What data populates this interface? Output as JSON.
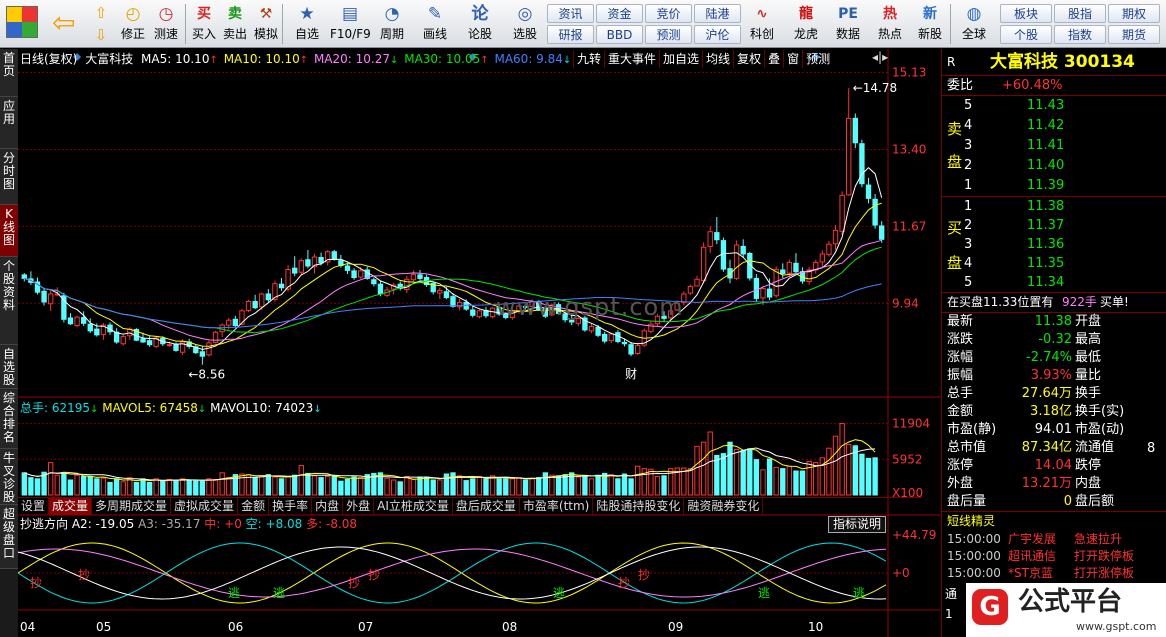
{
  "toolbar": {
    "nav": [
      {
        "label": "修正",
        "icon": "refresh-icon"
      },
      {
        "label": "测速",
        "icon": "clock-icon"
      }
    ],
    "trade": [
      {
        "label": "买入",
        "icon": "buy-icon",
        "ic": "买"
      },
      {
        "label": "卖出",
        "icon": "sell-icon",
        "ic": "卖"
      },
      {
        "label": "模拟",
        "icon": "hammer-icon",
        "ic": "⚒"
      }
    ],
    "tools": [
      {
        "label": "自选",
        "icon": "star-icon",
        "ic": "★"
      },
      {
        "label": "F10/F9",
        "icon": "f10-icon",
        "ic": "▤"
      },
      {
        "label": "周期",
        "icon": "cycle-icon",
        "ic": "◔"
      },
      {
        "label": "画线",
        "icon": "pencil-icon",
        "ic": "✎"
      },
      {
        "label": "论股",
        "icon": "chat-icon",
        "ic": "论"
      },
      {
        "label": "选股",
        "icon": "stock-pick-icon",
        "ic": "◎"
      }
    ],
    "small": [
      [
        "资讯",
        "资金",
        "竞价",
        "陆港"
      ],
      [
        "研报",
        "BBD",
        "预测",
        "沪伦"
      ]
    ],
    "more": [
      {
        "label": "科创",
        "icon": "chart-icon",
        "ic": "∿"
      },
      {
        "label": "龙虎",
        "icon": "dragon-icon",
        "ic": "龍"
      },
      {
        "label": "数据",
        "icon": "pe-icon",
        "ic": "PE"
      },
      {
        "label": "热点",
        "icon": "fire-icon",
        "ic": "热"
      },
      {
        "label": "新股",
        "icon": "ipo-icon",
        "ic": "新"
      }
    ],
    "globe": {
      "label": "全球",
      "icon": "globe-icon",
      "ic": "◍"
    },
    "small2": [
      [
        "板块",
        "股指",
        "期权"
      ],
      [
        "个股",
        "指数",
        "期货"
      ]
    ]
  },
  "leftbar": [
    {
      "label": "首页",
      "act": false
    },
    {
      "label": "应用",
      "act": false
    },
    {
      "label": "分时图",
      "act": false
    },
    {
      "label": "K线图",
      "act": true
    },
    {
      "label": "个股资料",
      "act": false
    },
    {
      "label": "自选股",
      "act": false
    },
    {
      "label": "综合排名",
      "act": false
    },
    {
      "label": "牛叉诊股",
      "act": false
    },
    {
      "label": "超级盘口",
      "act": false
    }
  ],
  "chart": {
    "header": {
      "period": "日线(复权)",
      "name": "大富科技",
      "ma5": "MA5: 10.10",
      "ma10": "MA10: 10.10",
      "ma20": "MA20: 10.27",
      "ma30": "MA30: 10.05",
      "ma60": "MA60: 9.84"
    },
    "top_buttons": [
      "九转",
      "重大事件",
      "加自选",
      "均线",
      "复权",
      "叠",
      "窗",
      "预测"
    ],
    "watermark": "www.gspt.com",
    "vol_header": {
      "total": "总手: 62195",
      "ma5": "MAVOL5: 67458",
      "ma10": "MAVOL10: 74023"
    },
    "tabs": [
      "设置",
      "成交量",
      "多周期成交量",
      "虚拟成交量",
      "金额",
      "换手率",
      "内盘",
      "外盘",
      "AI立桩成交量",
      "盘后成交量",
      "市盈率(ttm)",
      "陆股通持股变化",
      "融资融券变化"
    ],
    "ind_header": {
      "name": "抄逃方向",
      "a2": "A2: -19.05",
      "a3": "A3: -35.17",
      "zhong": "中: +0",
      "kong": "空: +8.08",
      "duo": "多: -8.08"
    },
    "ind_button": "指标说明",
    "xlabels": [
      "04",
      "05",
      "06",
      "07",
      "08",
      "09",
      "10"
    ],
    "marks": {
      "high": "14.78",
      "low": "8.56",
      "cai": "财",
      "chao": "抄",
      "tao": "逃"
    }
  },
  "chart_data": {
    "type": "candlestick",
    "price_ticks": [
      "15.13",
      "13.40",
      "11.67",
      "9.94"
    ],
    "volume_ticks": [
      "11904",
      "5952",
      "X100"
    ],
    "ind_ticks": [
      "+44.79",
      "+0"
    ],
    "ohlc": [
      [
        10.58,
        10.62,
        10.43,
        10.5
      ],
      [
        10.49,
        10.66,
        10.35,
        10.41
      ],
      [
        10.42,
        10.52,
        10.14,
        10.19
      ],
      [
        10.21,
        10.29,
        9.89,
        9.97
      ],
      [
        9.93,
        10.22,
        9.77,
        10.15
      ],
      [
        10.15,
        10.3,
        10.11,
        10.15
      ],
      [
        10.11,
        10.18,
        9.51,
        9.58
      ],
      [
        9.61,
        9.72,
        9.45,
        9.48
      ],
      [
        9.44,
        9.66,
        9.4,
        9.63
      ],
      [
        9.62,
        9.76,
        9.43,
        9.49
      ],
      [
        9.47,
        9.6,
        9.27,
        9.32
      ],
      [
        9.36,
        9.49,
        9.19,
        9.23
      ],
      [
        9.24,
        9.5,
        9.12,
        9.45
      ],
      [
        9.45,
        9.51,
        9.23,
        9.3
      ],
      [
        9.29,
        9.38,
        9.03,
        9.07
      ],
      [
        9.03,
        9.23,
        8.99,
        9.19
      ],
      [
        9.21,
        9.4,
        9.12,
        9.36
      ],
      [
        9.35,
        9.38,
        9.09,
        9.11
      ],
      [
        9.14,
        9.28,
        9.05,
        9.07
      ],
      [
        9.1,
        9.21,
        8.96,
        9.01
      ],
      [
        8.97,
        9.19,
        8.93,
        9.16
      ],
      [
        9.15,
        9.2,
        8.98,
        9.03
      ],
      [
        9.01,
        9.08,
        8.96,
        9.01
      ],
      [
        9.02,
        9.06,
        8.85,
        8.88
      ],
      [
        8.84,
        9.13,
        8.78,
        9.07
      ],
      [
        9.07,
        9.14,
        8.92,
        8.97
      ],
      [
        8.96,
        9.01,
        8.8,
        8.83
      ],
      [
        8.85,
        8.98,
        8.56,
        8.75
      ],
      [
        8.78,
        9.1,
        8.74,
        9.05
      ],
      [
        9.06,
        9.32,
        9.04,
        9.29
      ],
      [
        9.3,
        9.49,
        9.18,
        9.45
      ],
      [
        9.45,
        9.61,
        9.35,
        9.56
      ],
      [
        9.58,
        9.66,
        9.4,
        9.44
      ],
      [
        9.47,
        9.82,
        9.44,
        9.77
      ],
      [
        9.78,
        10.02,
        9.74,
        9.98
      ],
      [
        9.98,
        10.13,
        9.81,
        9.84
      ],
      [
        9.86,
        10.18,
        9.79,
        10.15
      ],
      [
        10.15,
        10.26,
        9.97,
        10.02
      ],
      [
        10.03,
        10.45,
        9.98,
        10.38
      ],
      [
        10.37,
        10.51,
        10.22,
        10.29
      ],
      [
        10.26,
        10.8,
        10.2,
        10.7
      ],
      [
        10.73,
        11.0,
        10.55,
        10.62
      ],
      [
        10.64,
        10.95,
        10.59,
        10.9
      ],
      [
        10.92,
        11.14,
        10.73,
        10.78
      ],
      [
        10.76,
        11.05,
        10.61,
        10.98
      ],
      [
        10.97,
        11.08,
        10.79,
        10.85
      ],
      [
        10.87,
        11.14,
        10.79,
        11.1
      ],
      [
        11.1,
        11.14,
        10.9,
        10.93
      ],
      [
        10.9,
        11.03,
        10.74,
        10.79
      ],
      [
        10.78,
        10.85,
        10.6,
        10.68
      ],
      [
        10.67,
        10.73,
        10.47,
        10.52
      ],
      [
        10.53,
        10.75,
        10.49,
        10.67
      ],
      [
        10.69,
        10.76,
        10.47,
        10.5
      ],
      [
        10.47,
        10.52,
        10.32,
        10.38
      ],
      [
        10.37,
        10.44,
        10.1,
        10.15
      ],
      [
        10.12,
        10.31,
        10.08,
        10.24
      ],
      [
        10.26,
        10.4,
        10.14,
        10.35
      ],
      [
        10.37,
        10.43,
        10.23,
        10.28
      ],
      [
        10.25,
        10.56,
        10.17,
        10.48
      ],
      [
        10.47,
        10.68,
        10.41,
        10.59
      ],
      [
        10.58,
        10.69,
        10.45,
        10.5
      ],
      [
        10.52,
        10.58,
        10.31,
        10.36
      ],
      [
        10.39,
        10.43,
        10.14,
        10.2
      ],
      [
        10.17,
        10.29,
        10.04,
        10.23
      ],
      [
        10.2,
        10.31,
        10.03,
        10.07
      ],
      [
        10.09,
        10.17,
        9.84,
        9.87
      ],
      [
        9.86,
        10.04,
        9.78,
        9.96
      ],
      [
        9.96,
        10.03,
        9.77,
        9.81
      ],
      [
        9.79,
        9.9,
        9.62,
        9.67
      ],
      [
        9.64,
        9.81,
        9.6,
        9.77
      ],
      [
        9.78,
        9.86,
        9.61,
        9.66
      ],
      [
        9.64,
        9.86,
        9.6,
        9.83
      ],
      [
        9.84,
        9.9,
        9.66,
        9.7
      ],
      [
        9.69,
        9.73,
        9.58,
        9.62
      ],
      [
        9.62,
        9.81,
        9.57,
        9.78
      ],
      [
        9.77,
        9.95,
        9.71,
        9.88
      ],
      [
        9.87,
        9.94,
        9.8,
        9.85
      ],
      [
        9.87,
        10.03,
        9.85,
        9.98
      ],
      [
        9.98,
        10.01,
        9.77,
        9.8
      ],
      [
        9.81,
        9.85,
        9.61,
        9.65
      ],
      [
        9.68,
        9.93,
        9.65,
        9.9
      ],
      [
        9.91,
        9.96,
        9.68,
        9.71
      ],
      [
        9.7,
        9.75,
        9.51,
        9.57
      ],
      [
        9.56,
        9.69,
        9.45,
        9.52
      ],
      [
        9.49,
        9.64,
        9.43,
        9.6
      ],
      [
        9.61,
        9.66,
        9.3,
        9.34
      ],
      [
        9.32,
        9.48,
        9.27,
        9.42
      ],
      [
        9.4,
        9.45,
        9.18,
        9.22
      ],
      [
        9.24,
        9.3,
        9.04,
        9.09
      ],
      [
        9.1,
        9.28,
        9.05,
        9.25
      ],
      [
        9.28,
        9.34,
        9.04,
        9.08
      ],
      [
        9.06,
        9.15,
        8.97,
        9.03
      ],
      [
        9.01,
        9.07,
        8.75,
        8.8
      ],
      [
        8.81,
        9.05,
        8.78,
        8.99
      ],
      [
        9.0,
        9.37,
        8.96,
        9.32
      ],
      [
        9.31,
        9.53,
        9.26,
        9.47
      ],
      [
        9.48,
        9.7,
        9.42,
        9.65
      ],
      [
        9.65,
        9.76,
        9.52,
        9.6
      ],
      [
        9.61,
        9.82,
        9.54,
        9.77
      ],
      [
        9.79,
        10.0,
        9.77,
        9.94
      ],
      [
        9.96,
        10.21,
        9.89,
        10.15
      ],
      [
        10.17,
        10.36,
        10.13,
        10.32
      ],
      [
        10.33,
        10.56,
        10.32,
        10.48
      ],
      [
        10.45,
        11.31,
        10.39,
        11.2
      ],
      [
        11.22,
        11.67,
        11.07,
        11.55
      ],
      [
        11.53,
        11.88,
        11.27,
        11.37
      ],
      [
        11.35,
        11.42,
        10.65,
        10.71
      ],
      [
        10.72,
        10.92,
        10.39,
        10.51
      ],
      [
        10.5,
        11.35,
        10.46,
        11.25
      ],
      [
        11.22,
        11.38,
        10.96,
        11.05
      ],
      [
        11.06,
        11.1,
        10.45,
        10.51
      ],
      [
        10.5,
        10.6,
        9.97,
        10.05
      ],
      [
        10.06,
        10.33,
        9.9,
        10.27
      ],
      [
        10.26,
        10.5,
        10.01,
        10.08
      ],
      [
        10.11,
        10.77,
        10.06,
        10.7
      ],
      [
        10.69,
        10.84,
        10.51,
        10.61
      ],
      [
        10.62,
        10.92,
        10.53,
        10.86
      ],
      [
        10.84,
        11.07,
        10.59,
        10.65
      ],
      [
        10.65,
        10.75,
        10.38,
        10.44
      ],
      [
        10.43,
        10.76,
        10.36,
        10.69
      ],
      [
        10.69,
        10.92,
        10.61,
        10.86
      ],
      [
        10.87,
        11.13,
        10.76,
        11.05
      ],
      [
        11.04,
        11.34,
        10.99,
        11.27
      ],
      [
        11.28,
        11.7,
        11.14,
        11.58
      ],
      [
        11.56,
        12.46,
        11.48,
        12.37
      ],
      [
        12.38,
        14.78,
        12.36,
        14.1
      ],
      [
        14.1,
        14.21,
        13.43,
        13.55
      ],
      [
        13.53,
        13.62,
        12.55,
        12.63
      ],
      [
        12.6,
        12.76,
        12.19,
        12.3
      ],
      [
        12.28,
        12.4,
        11.62,
        11.7
      ],
      [
        11.68,
        11.79,
        11.3,
        11.38
      ]
    ],
    "volume": [
      3700,
      2900,
      2700,
      3800,
      5400,
      3300,
      3700,
      2500,
      3300,
      3100,
      3100,
      2700,
      2800,
      2100,
      2700,
      2200,
      2900,
      2100,
      2700,
      2100,
      2700,
      2400,
      2600,
      2500,
      2700,
      2500,
      2300,
      2300,
      2700,
      2600,
      3700,
      2900,
      3400,
      3500,
      3400,
      2900,
      3000,
      3400,
      3000,
      2700,
      3000,
      3300,
      4900,
      3600,
      3200,
      2900,
      3100,
      3100,
      2300,
      2600,
      3000,
      2900,
      3400,
      3600,
      3700,
      2800,
      2500,
      2200,
      3100,
      2600,
      3000,
      3000,
      2500,
      2500,
      3500,
      3700,
      3200,
      2400,
      2700,
      3100,
      2700,
      3200,
      2700,
      2700,
      2700,
      2900,
      2500,
      2800,
      2900,
      3700,
      3300,
      3200,
      3400,
      3700,
      3000,
      3100,
      2700,
      3300,
      3600,
      3400,
      2700,
      3500,
      2700,
      4800,
      4400,
      4300,
      3100,
      3200,
      4400,
      4500,
      4500,
      4400,
      8100,
      8800,
      10500,
      6600,
      6900,
      8800,
      7600,
      7400,
      7700,
      5900,
      4200,
      6000,
      4600,
      4400,
      4800,
      4000,
      4000,
      5600,
      5400,
      6200,
      7800,
      9800,
      11904,
      8400,
      8200,
      6800,
      6100,
      6200
    ],
    "ylim": [
      7.9,
      15.3
    ]
  },
  "quote": {
    "code_label": "R",
    "title": "大富科技 300134",
    "weibi_label": "委比",
    "weibi": "+60.48%",
    "sell_label": [
      "卖",
      "盘"
    ],
    "buy_label": [
      "买",
      "盘"
    ],
    "sell": [
      {
        "n": "5",
        "p": "11.43"
      },
      {
        "n": "4",
        "p": "11.42"
      },
      {
        "n": "3",
        "p": "11.41"
      },
      {
        "n": "2",
        "p": "11.40"
      },
      {
        "n": "1",
        "p": "11.39"
      }
    ],
    "buy": [
      {
        "n": "1",
        "p": "11.38"
      },
      {
        "n": "2",
        "p": "11.37"
      },
      {
        "n": "3",
        "p": "11.36"
      },
      {
        "n": "4",
        "p": "11.35"
      },
      {
        "n": "5",
        "p": "11.34"
      }
    ],
    "notice": {
      "a": "在买盘11.33位置有",
      "b": "922手",
      "c": "买单!"
    },
    "rows": [
      {
        "k": "最新",
        "v": "11.38",
        "vc": "grn",
        "k2": "开盘"
      },
      {
        "k": "涨跌",
        "v": "-0.32",
        "vc": "grn",
        "k2": "最高"
      },
      {
        "k": "涨幅",
        "v": "-2.74%",
        "vc": "grn",
        "k2": "最低"
      },
      {
        "k": "振幅",
        "v": "3.93%",
        "vc": "red",
        "k2": "量比"
      },
      {
        "k": "总手",
        "v": "27.64万",
        "vc": "yel",
        "k2": "换手"
      },
      {
        "k": "金额",
        "v": "3.18亿",
        "vc": "yel",
        "k2": "换手(实)"
      },
      {
        "k": "市盈(静)",
        "v": "94.01",
        "vc": "wht",
        "k2": "市盈(动)"
      },
      {
        "k": "总市值",
        "v": "87.34亿",
        "vc": "yel",
        "k2": "流通值"
      },
      {
        "k": "涨停",
        "v": "14.04",
        "vc": "red",
        "k2": "跌停"
      },
      {
        "k": "外盘",
        "v": "13.21万",
        "vc": "red",
        "k2": "内盘"
      },
      {
        "k": "盘后量",
        "v": "0",
        "vc": "yel",
        "k2": "盘后额"
      }
    ],
    "extra": {
      "liutong": "8"
    },
    "news_title": "短线精灵",
    "news": [
      {
        "t": "15:00:00",
        "s": "广宇发展",
        "e": "急速拉升"
      },
      {
        "t": "15:00:00",
        "s": "超讯通信",
        "e": "打开跌停板"
      },
      {
        "t": "15:00:00",
        "s": "*ST京蓝",
        "e": "打开涨停板"
      }
    ],
    "bottom_tabs": [
      "通",
      "1"
    ],
    "logo": {
      "text": "公式平台",
      "url": "www.gspt.com"
    }
  },
  "colors": {
    "up": "#ff3232",
    "down": "#54ffff",
    "ma5": "#ffffff",
    "ma10": "#ffff00",
    "ma20": "#ff80ff",
    "ma30": "#00e600",
    "ma60": "#4080ff",
    "grid": "#7a0000"
  }
}
